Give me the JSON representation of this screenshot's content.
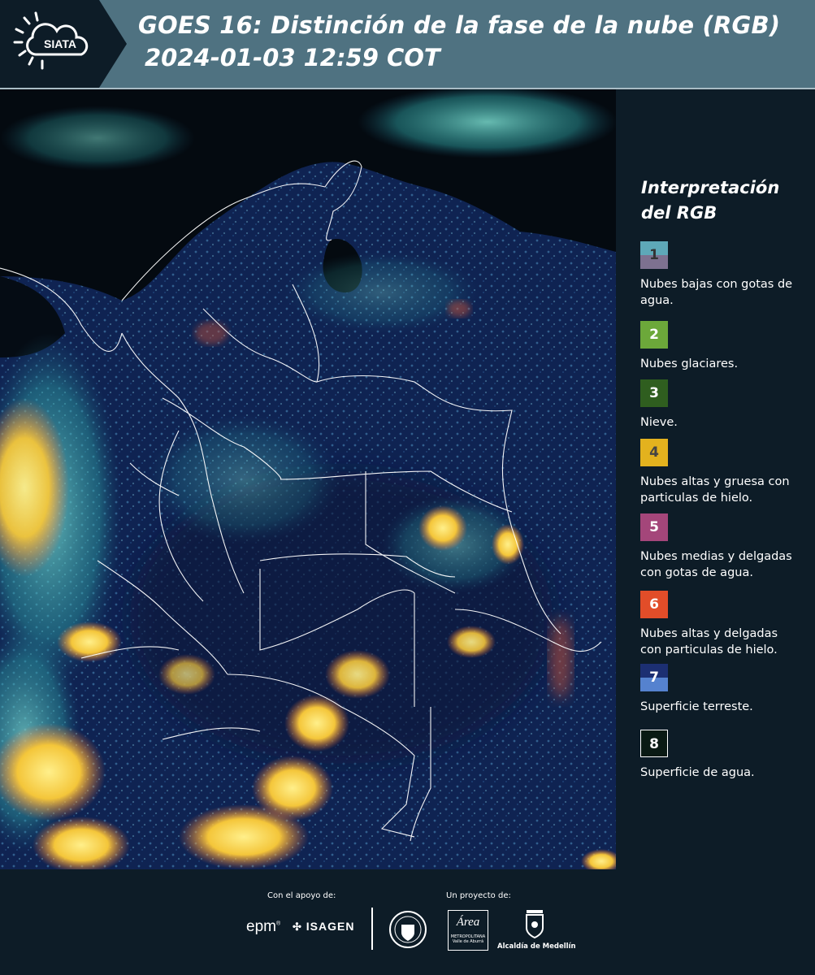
{
  "header": {
    "logo_text": "SIATA",
    "title_line1": "GOES 16: Distinción de la fase de la nube (RGB)",
    "title_line2": "2024-01-03 12:59 COT"
  },
  "legend": {
    "title_line1": "Interpretación",
    "title_line2": "del RGB",
    "items": [
      {
        "num": "1",
        "label": "Nubes bajas con gotas de agua.",
        "color_top": "#5ea8b8",
        "color_bottom": "#7d7190"
      },
      {
        "num": "2",
        "label": "Nubes glaciares.",
        "color_top": "#6ca83a",
        "color_bottom": "#6ca83a"
      },
      {
        "num": "3",
        "label": "Nieve.",
        "color_top": "#2f5e1f",
        "color_bottom": "#2f5e1f"
      },
      {
        "num": "4",
        "label": "Nubes altas y gruesa con particulas de hielo.",
        "color_top": "#e3b21e",
        "color_bottom": "#e3b21e"
      },
      {
        "num": "5",
        "label": "Nubes medias y delgadas con gotas de agua.",
        "color_top": "#a4467a",
        "color_bottom": "#a4467a"
      },
      {
        "num": "6",
        "label": "Nubes altas y delgadas con particulas de hielo.",
        "color_top": "#e24d29",
        "color_bottom": "#e24d29"
      },
      {
        "num": "7",
        "label": "Superficie terreste.",
        "color_top": "#1c2f72",
        "color_bottom": "#5582cf"
      },
      {
        "num": "8",
        "label": "Superficie de agua.",
        "color_top": "#0a1a14",
        "color_bottom": "#0a1a14"
      }
    ]
  },
  "footer": {
    "support_label": "Con el apoyo de:",
    "project_label": "Un proyecto de:",
    "sponsor_epm": "epm",
    "sponsor_isagen": "ISAGEN",
    "area_name": "Área",
    "area_sub1": "METROPOLITANA",
    "area_sub2": "Valle de Aburrá",
    "alcaldia": "Alcaldía de Medellín"
  }
}
